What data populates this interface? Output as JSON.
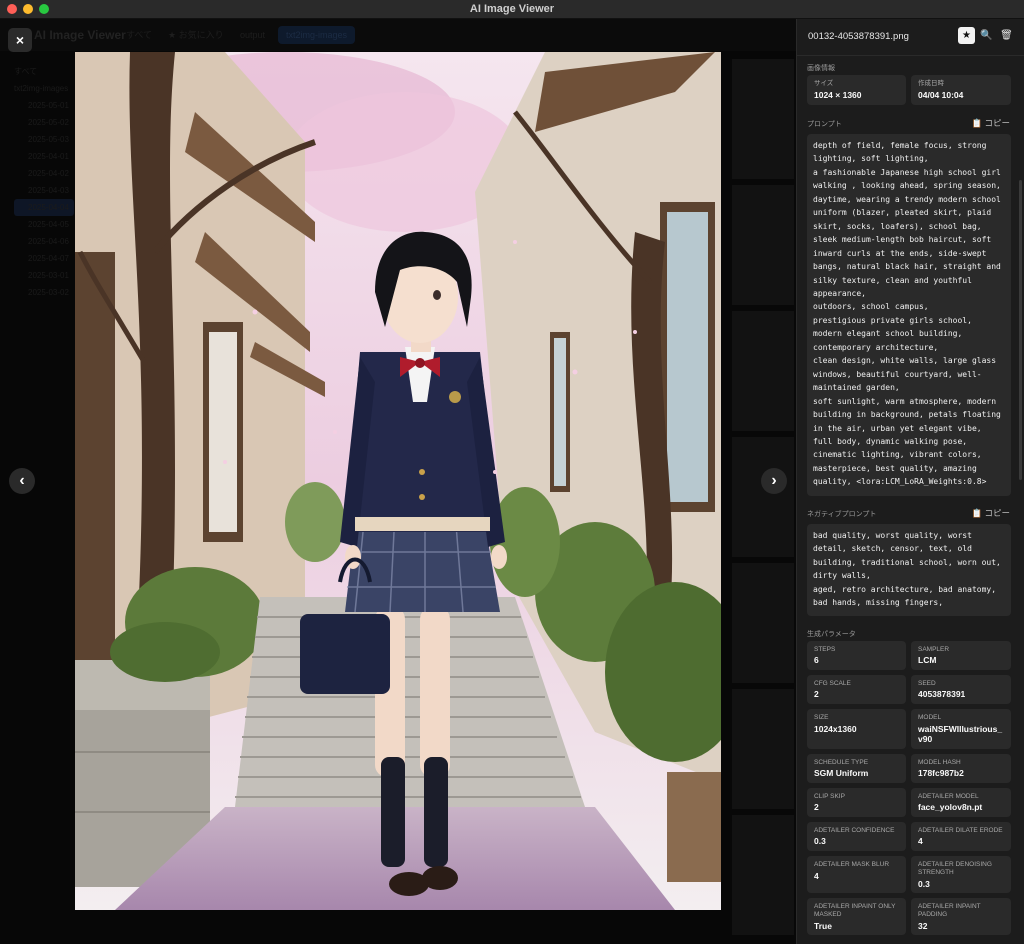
{
  "window": {
    "title": "AI Image Viewer"
  },
  "background_app": {
    "app_name": "AI Image Viewer",
    "tabs": [
      "すべて",
      "★ お気に入り",
      "output",
      "txt2img-images"
    ],
    "sidebar_items": [
      "すべて",
      "txt2img-images",
      "2025-05-01",
      "2025-05-02",
      "2025-05-03",
      "2025-04-01",
      "2025-04-02",
      "2025-04-03",
      "2025-04-04",
      "2025-04-05",
      "2025-04-06",
      "2025-04-07",
      "2025-03-01",
      "2025-03-02"
    ]
  },
  "viewer": {
    "close_symbol": "×",
    "prev_symbol": "‹",
    "next_symbol": "›",
    "image_subject": "anime-girl-school-uniform-illustration"
  },
  "panel": {
    "filename": "00132-4053878391.png",
    "header_icons": [
      "star-icon",
      "search-icon",
      "trash-icon"
    ],
    "image_info_title": "画像情報",
    "size_label": "サイズ",
    "size_value": "1024 × 1360",
    "created_label": "作成日時",
    "created_value": "04/04 10:04",
    "prompt_title": "プロンプト",
    "copy_label": "📋 コピー",
    "prompt_text": "depth of field, female focus, strong lighting, soft lighting,\na fashionable Japanese high school girl walking , looking ahead, spring season, daytime, wearing a trendy modern school uniform (blazer, pleated skirt, plaid skirt, socks, loafers), school bag, sleek medium-length bob haircut, soft inward curls at the ends, side-swept bangs, natural black hair, straight and silky texture, clean and youthful appearance,\noutdoors, school campus,\nprestigious private girls school,\nmodern elegant school building,\ncontemporary architecture,\nclean design, white walls, large glass windows, beautiful courtyard, well-maintained garden,\nsoft sunlight, warm atmosphere, modern building in background, petals floating in the air, urban yet elegant vibe,\nfull body, dynamic walking pose,\ncinematic lighting, vibrant colors,\nmasterpiece, best quality, amazing quality, <lora:LCM_LoRA_Weights:0.8>",
    "negative_title": "ネガティブプロンプト",
    "negative_text": "bad quality, worst quality, worst detail, sketch, censor, text, old building, traditional school, worn out, dirty walls,\naged, retro architecture, bad anatomy, bad hands, missing fingers,",
    "params_title": "生成パラメータ",
    "params": [
      {
        "label": "STEPS",
        "value": "6"
      },
      {
        "label": "SAMPLER",
        "value": "LCM"
      },
      {
        "label": "CFG SCALE",
        "value": "2"
      },
      {
        "label": "SEED",
        "value": "4053878391"
      },
      {
        "label": "SIZE",
        "value": "1024x1360"
      },
      {
        "label": "MODEL",
        "value": "waiNSFWIllustrious_v90"
      },
      {
        "label": "SCHEDULE TYPE",
        "value": "SGM Uniform"
      },
      {
        "label": "MODEL HASH",
        "value": "178fc987b2"
      },
      {
        "label": "CLIP SKIP",
        "value": "2"
      },
      {
        "label": "ADETAILER MODEL",
        "value": "face_yolov8n.pt"
      },
      {
        "label": "ADETAILER CONFIDENCE",
        "value": "0.3"
      },
      {
        "label": "ADETAILER DILATE ERODE",
        "value": "4"
      },
      {
        "label": "ADETAILER MASK BLUR",
        "value": "4"
      },
      {
        "label": "ADETAILER DENOISING STRENGTH",
        "value": "0.3"
      },
      {
        "label": "ADETAILER INPAINT ONLY MASKED",
        "value": "True"
      },
      {
        "label": "ADETAILER INPAINT PADDING",
        "value": "32"
      }
    ]
  },
  "colors": {
    "panel_bg": "#1c1c1c",
    "card_bg": "#2a2a2a",
    "sky_pink": "#e8c4dc",
    "blazer_navy": "#23284a",
    "bow_red": "#b01c2c"
  }
}
